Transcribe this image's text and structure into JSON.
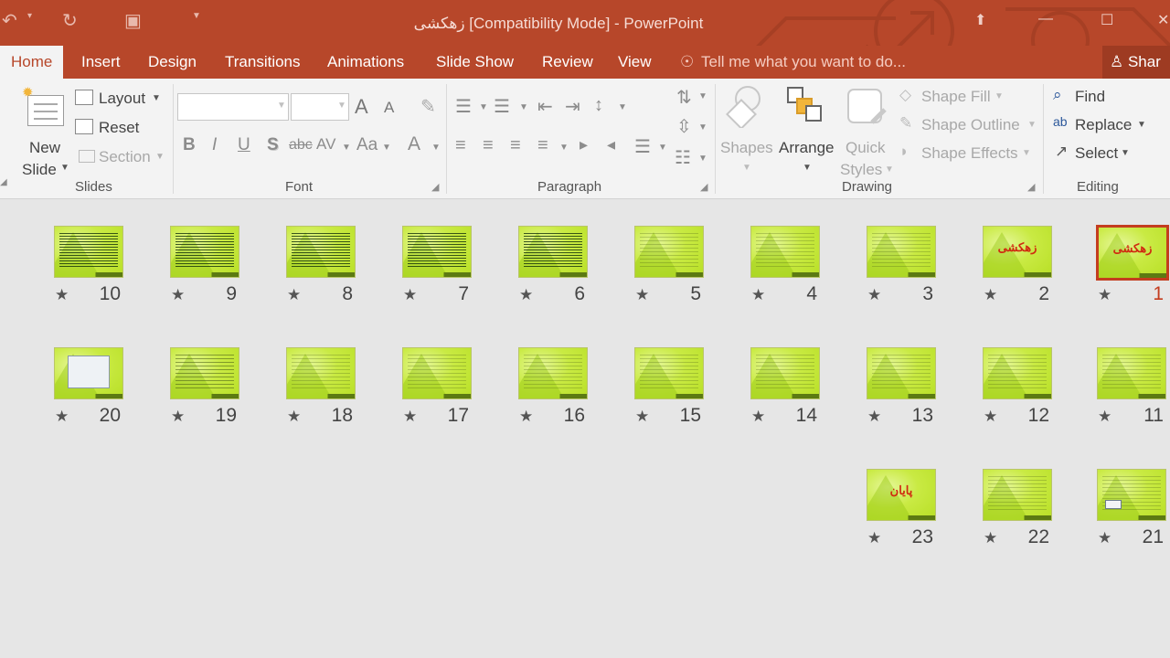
{
  "window": {
    "title": "زهکشی [Compatibility Mode] - PowerPoint"
  },
  "tabs": [
    {
      "label": "Home",
      "active": true
    },
    {
      "label": "Insert"
    },
    {
      "label": "Design"
    },
    {
      "label": "Transitions"
    },
    {
      "label": "Animations"
    },
    {
      "label": "Slide Show"
    },
    {
      "label": "Review"
    },
    {
      "label": "View"
    }
  ],
  "tellme": {
    "placeholder": "Tell me what you want to do..."
  },
  "share": {
    "label": "Shar"
  },
  "ribbon": {
    "slides": {
      "new_slide_1": "New",
      "new_slide_2": "Slide",
      "layout": "Layout",
      "reset": "Reset",
      "section": "Section",
      "group": "Slides"
    },
    "font": {
      "bold": "B",
      "italic": "I",
      "underline": "U",
      "shadow": "S",
      "strike": "abc",
      "spacing": "AV",
      "case": "Aa",
      "color": "A",
      "grow": "A",
      "shrink": "A",
      "group": "Font"
    },
    "paragraph": {
      "group": "Paragraph"
    },
    "drawing": {
      "shapes": "Shapes",
      "arrange": "Arrange",
      "quick_1": "Quick",
      "quick_2": "Styles",
      "shape_fill": "Shape Fill",
      "shape_outline": "Shape Outline",
      "shape_effects": "Shape Effects",
      "group": "Drawing"
    },
    "editing": {
      "find": "Find",
      "replace": "Replace",
      "select": "Select",
      "group": "Editing"
    }
  },
  "slides": [
    {
      "number": "1",
      "kind": "title",
      "text": "زهکشی",
      "selected": true
    },
    {
      "number": "2",
      "kind": "title",
      "text": "زهکشی"
    },
    {
      "number": "3",
      "kind": "sparse"
    },
    {
      "number": "4",
      "kind": "sparse"
    },
    {
      "number": "5",
      "kind": "sparse"
    },
    {
      "number": "6",
      "kind": "dense"
    },
    {
      "number": "7",
      "kind": "dense"
    },
    {
      "number": "8",
      "kind": "dense"
    },
    {
      "number": "9",
      "kind": "dense"
    },
    {
      "number": "10",
      "kind": "dense"
    },
    {
      "number": "11",
      "kind": "sparse"
    },
    {
      "number": "12",
      "kind": "sparse"
    },
    {
      "number": "13",
      "kind": "sparse"
    },
    {
      "number": "14",
      "kind": "sparse"
    },
    {
      "number": "15",
      "kind": "sparse"
    },
    {
      "number": "16",
      "kind": "sparse"
    },
    {
      "number": "17",
      "kind": "sparse"
    },
    {
      "number": "18",
      "kind": "sparse"
    },
    {
      "number": "19",
      "kind": "table"
    },
    {
      "number": "20",
      "kind": "picture"
    },
    {
      "number": "21",
      "kind": "smallpic"
    },
    {
      "number": "22",
      "kind": "sparse"
    },
    {
      "number": "23",
      "kind": "title",
      "text": "پایان"
    }
  ]
}
